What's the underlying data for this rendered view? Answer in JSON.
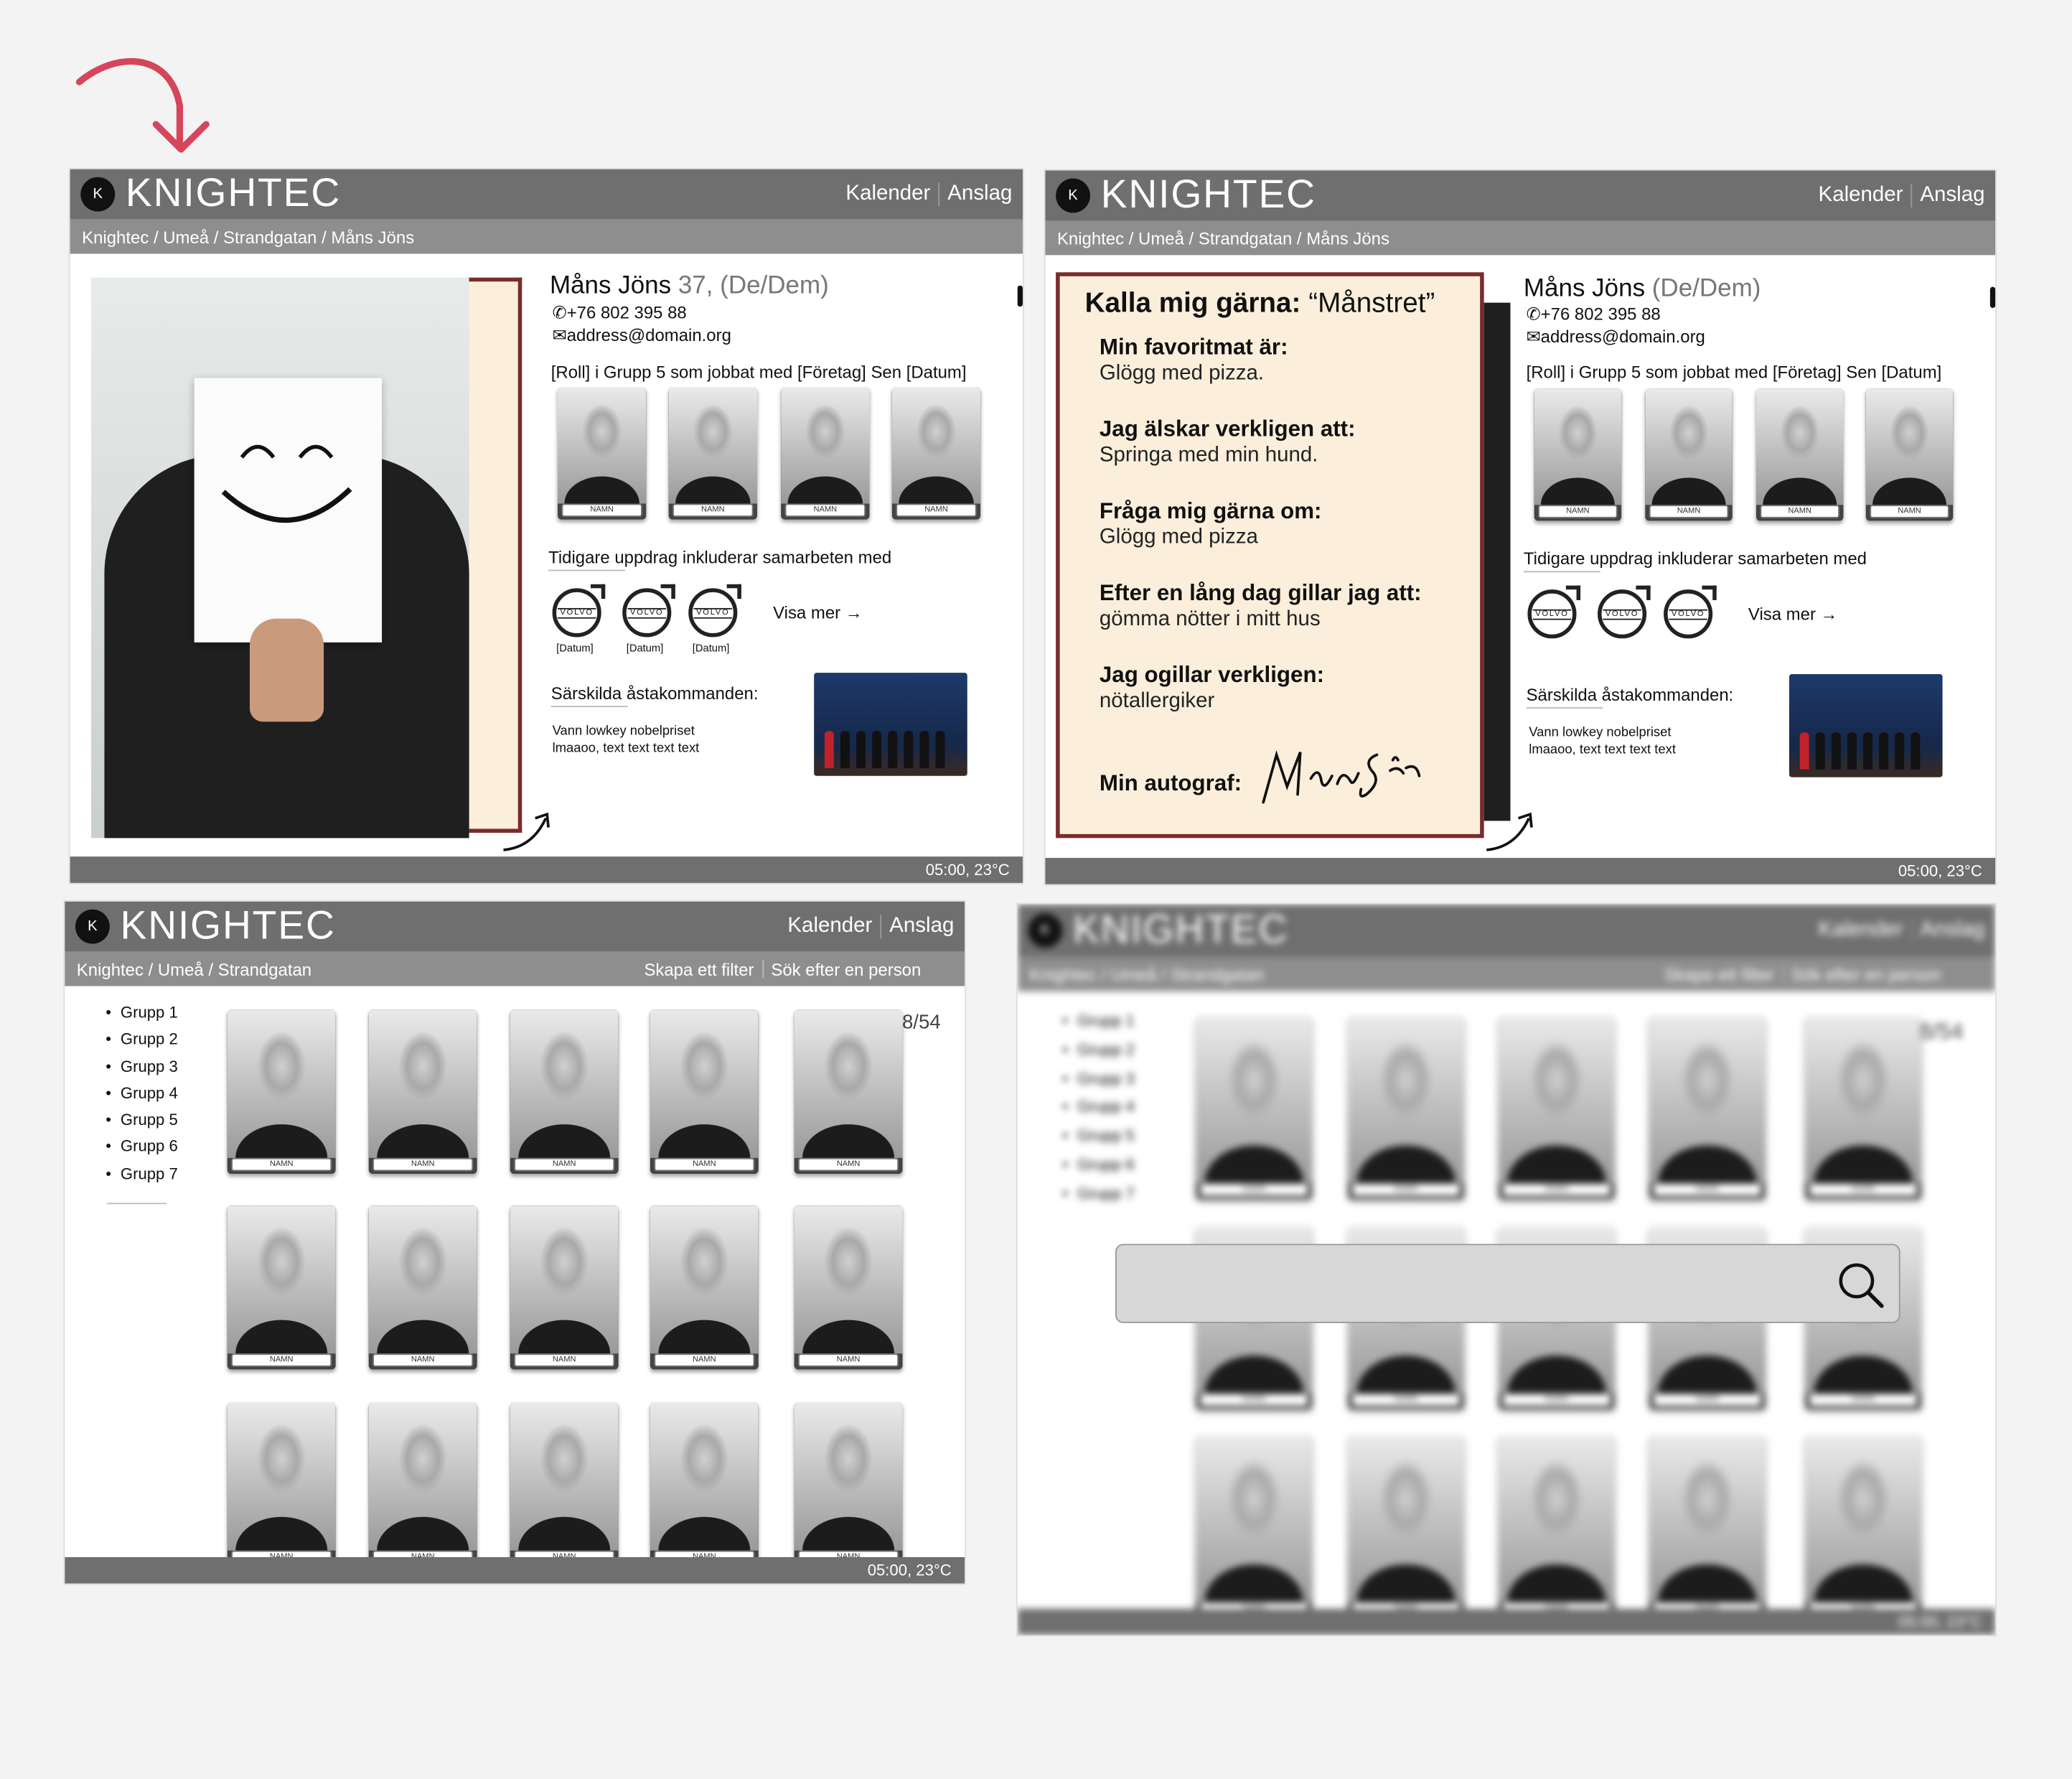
{
  "brand": {
    "logo_text": "KNIGHTEC",
    "accent": "#7a2b2e",
    "header_color": "#6f6f6f"
  },
  "nav": {
    "kalender": "Kalender",
    "anslag": "Anslag"
  },
  "footer": {
    "status": "05:00, 23°C"
  },
  "profile": {
    "breadcrumb": "Knightec / Umeå / Strandgatan / Måns Jöns",
    "name": "Måns Jöns",
    "age_pronouns": "37, (De/Dem)",
    "pronouns": "(De/Dem)",
    "phone": "+76 802 395 88",
    "email": "address@domain.org",
    "role_line": "[Roll] i Grupp 5 som jobbat med [Företag] Sen [Datum]",
    "colleague_label": "NAMN",
    "previous_label": "Tidigare uppdrag inkluderar samarbeten med",
    "client_logo": "VOLVO",
    "client_date": "[Datum]",
    "visa_mer": "Visa mer →",
    "achievements_label": "Särskilda åstakommanden:",
    "achievement_1": "Vann lowkey nobelpriset",
    "achievement_2": "lmaaoo, text text text text"
  },
  "about_card": {
    "title_bold": "Kalla mig gärna:",
    "title_value": "“Månstret”",
    "items": [
      {
        "q": "Min favoritmat är:",
        "a": "Glögg med pizza."
      },
      {
        "q": "Jag älskar verkligen att:",
        "a": "Springa med min hund."
      },
      {
        "q": "Fråga mig gärna om:",
        "a": "Glögg med pizza"
      },
      {
        "q": "Efter en lång dag gillar jag att:",
        "a": "gömma nötter i mitt hus"
      },
      {
        "q": "Jag ogillar verkligen:",
        "a": "nötallergiker"
      }
    ],
    "autograph_label": "Min autograf:",
    "autograph": "Måns Jöns"
  },
  "directory": {
    "breadcrumb": "Knightec / Umeå / Strandgatan",
    "filter": "Skapa ett filter",
    "search": "Sök efter en person",
    "groups": [
      "Grupp 1",
      "Grupp 2",
      "Grupp 3",
      "Grupp 4",
      "Grupp 5",
      "Grupp 6",
      "Grupp 7"
    ],
    "count": "0-18/54",
    "card_label": "NAMN"
  },
  "search_overlay": {
    "icon": "search-icon"
  }
}
